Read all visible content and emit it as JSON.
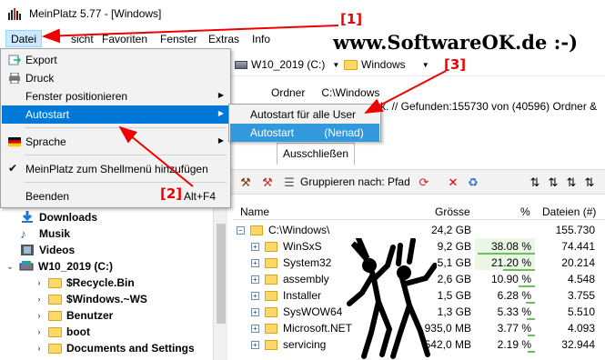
{
  "window": {
    "title": "MeinPlatz 5.77 - [Windows]",
    "app_icon": "meinplatz-app-icon"
  },
  "watermark": "www.SoftwareOK.de :-)",
  "menubar": [
    "Datei",
    "Ansicht",
    "Favoriten",
    "Fenster",
    "Extras",
    "Info"
  ],
  "menubar_visible": [
    "Datei",
    "sicht",
    "Favoriten",
    "Fenster",
    "Extras",
    "Info"
  ],
  "datei_menu": {
    "items": [
      {
        "label": "Export",
        "icon": "export-icon"
      },
      {
        "label": "Druck",
        "icon": "print-icon"
      },
      {
        "label": "Fenster positionieren",
        "submenu": true
      },
      {
        "label": "Autostart",
        "submenu": true,
        "selected": true
      },
      {
        "label": "Sprache",
        "icon": "german-flag-icon",
        "submenu": true
      },
      {
        "label": "MeinPlatz zum Shellmenü hinzufügen",
        "checked": true
      },
      {
        "label": "Beenden",
        "shortcut": "Alt+F4"
      }
    ]
  },
  "autostart_submenu": {
    "items": [
      {
        "label": "Autostart für alle User"
      },
      {
        "label": "Autostart          (Nenad)",
        "selected": true
      }
    ]
  },
  "toolbar": {
    "drive": "W10_2019 (C:)",
    "folder": "Windows"
  },
  "ordner": {
    "label": "Ordner",
    "value": "C:\\Windows"
  },
  "status": "k. //   Gefunden:155730 von (40596) Ordner &",
  "tab": "Ausschließen",
  "group_by": "Gruppieren nach: Pfad",
  "tree": [
    {
      "label": "Downloads",
      "icon": "download-icon"
    },
    {
      "label": "Musik",
      "icon": "music-icon"
    },
    {
      "label": "Videos",
      "icon": "video-icon"
    },
    {
      "label": "W10_2019 (C:)",
      "icon": "drive-icon"
    },
    {
      "label": "$Recycle.Bin",
      "icon": "folder-icon"
    },
    {
      "label": "$Windows.~WS",
      "icon": "folder-icon"
    },
    {
      "label": "Benutzer",
      "icon": "folder-icon"
    },
    {
      "label": "boot",
      "icon": "folder-icon"
    },
    {
      "label": "Documents and Settings",
      "icon": "folder-icon"
    }
  ],
  "grid": {
    "columns": [
      "Name",
      "Grösse",
      "%",
      "Dateien (#)"
    ],
    "rows": [
      {
        "name": "C:\\Windows\\",
        "size": "24,2 GB",
        "pct": "",
        "pct_value": 0,
        "files": "155.730"
      },
      {
        "name": "WinSxS",
        "size": "9,2 GB",
        "pct": "38.08 %",
        "pct_value": 38.08,
        "files": "74.441"
      },
      {
        "name": "System32",
        "size": "5,1 GB",
        "pct": "21.20 %",
        "pct_value": 21.2,
        "files": "20.214"
      },
      {
        "name": "assembly",
        "size": "2,6 GB",
        "pct": "10.90 %",
        "pct_value": 10.9,
        "files": "4.548"
      },
      {
        "name": "Installer",
        "size": "1,5 GB",
        "pct": "6.28 %",
        "pct_value": 6.28,
        "files": "3.755"
      },
      {
        "name": "SysWOW64",
        "size": "1,3 GB",
        "pct": "5.33 %",
        "pct_value": 5.33,
        "files": "5.510"
      },
      {
        "name": "Microsoft.NET",
        "size": "935,0 MB",
        "pct": "3.77 %",
        "pct_value": 3.77,
        "files": "4.093"
      },
      {
        "name": "servicing",
        "size": "542,0 MB",
        "pct": "2.19 %",
        "pct_value": 2.19,
        "files": "32.944"
      }
    ]
  },
  "callouts": [
    "[1]",
    "[2]",
    "[3]"
  ],
  "colors": {
    "menu_selected": "#0078d7",
    "callout": "#e00000",
    "percent_bar": "#6cbf5a"
  }
}
